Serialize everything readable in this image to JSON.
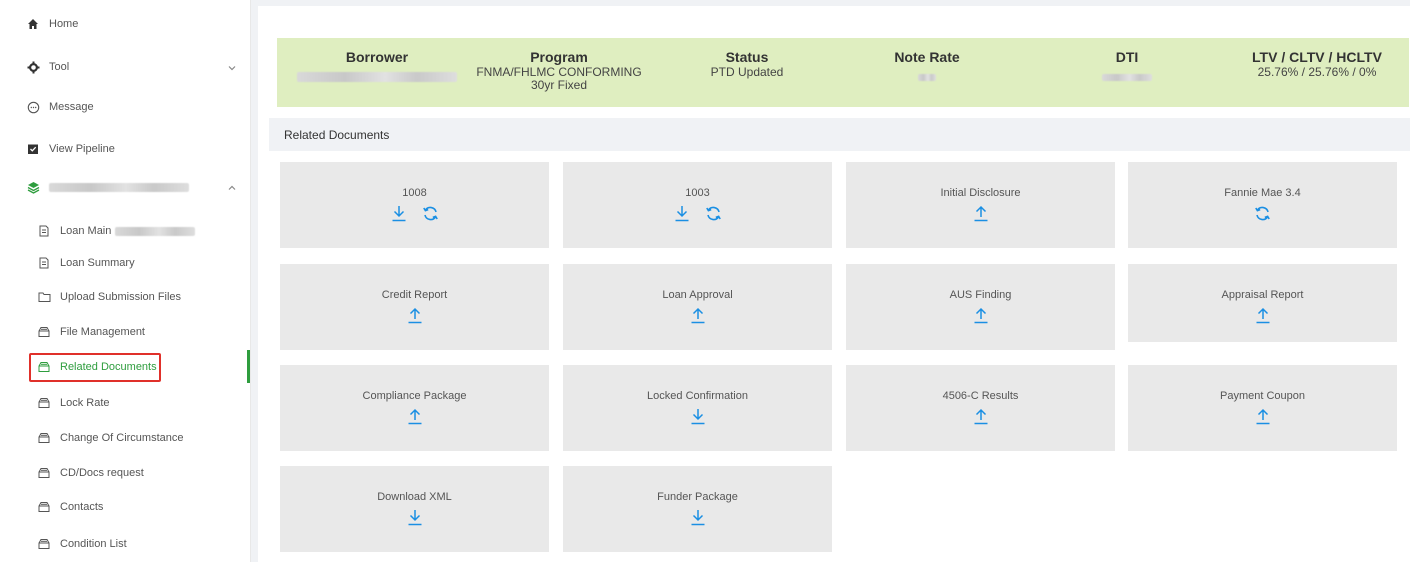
{
  "sidebar": {
    "home": "Home",
    "tool": "Tool",
    "message": "Message",
    "view_pipeline": "View Pipeline",
    "loan_main": "Loan Main",
    "loan_summary": "Loan Summary",
    "upload_submission_files": "Upload Submission Files",
    "file_management": "File Management",
    "related_documents": "Related Documents",
    "lock_rate": "Lock Rate",
    "change_of_circumstance": "Change Of Circumstance",
    "cd_docs_request": "CD/Docs request",
    "contacts": "Contacts",
    "condition_list": "Condition List",
    "active_color": "#2e9d3e"
  },
  "summary": {
    "borrower_h": "Borrower",
    "program_h": "Program",
    "program_v1": "FNMA/FHLMC CONFORMING",
    "program_v2": "30yr Fixed",
    "status_h": "Status",
    "status_v": "PTD Updated",
    "note_rate_h": "Note Rate",
    "dti_h": "DTI",
    "ltv_h": "LTV / CLTV / HCLTV",
    "ltv_v": "25.76% / 25.76% / 0%",
    "bg_color": "#dfeec0"
  },
  "related": {
    "title": "Related Documents",
    "cards": [
      {
        "title": "1008",
        "icons": [
          "download",
          "refresh"
        ]
      },
      {
        "title": "1003",
        "icons": [
          "download",
          "refresh"
        ]
      },
      {
        "title": "Initial Disclosure",
        "icons": [
          "upload"
        ]
      },
      {
        "title": "Fannie Mae 3.4",
        "icons": [
          "refresh"
        ]
      },
      {
        "title": "Credit Report",
        "icons": [
          "upload"
        ]
      },
      {
        "title": "Loan Approval",
        "icons": [
          "upload"
        ]
      },
      {
        "title": "AUS Finding",
        "icons": [
          "upload"
        ]
      },
      {
        "title": "Appraisal Report",
        "icons": [
          "upload"
        ]
      },
      {
        "title": "Compliance Package",
        "icons": [
          "upload"
        ]
      },
      {
        "title": "Locked Confirmation",
        "icons": [
          "download"
        ]
      },
      {
        "title": "4506-C Results",
        "icons": [
          "upload"
        ]
      },
      {
        "title": "Payment Coupon",
        "icons": [
          "upload"
        ]
      },
      {
        "title": "Download XML",
        "icons": [
          "download"
        ]
      },
      {
        "title": "Funder Package",
        "icons": [
          "download"
        ]
      }
    ],
    "icon_color": "#1a8fe3"
  }
}
